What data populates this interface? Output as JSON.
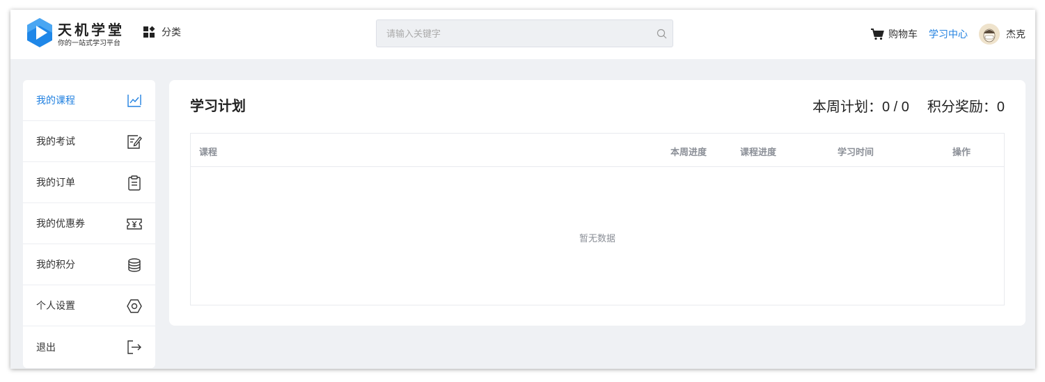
{
  "header": {
    "logo_title": "天机学堂",
    "logo_subtitle": "你的一站式学习平台",
    "category_label": "分类",
    "search_placeholder": "请输入关键字",
    "cart_label": "购物车",
    "study_center_label": "学习中心",
    "username": "杰克"
  },
  "sidebar": {
    "items": [
      {
        "label": "我的课程",
        "icon": "chart-icon",
        "active": true
      },
      {
        "label": "我的考试",
        "icon": "edit-icon"
      },
      {
        "label": "我的订单",
        "icon": "clipboard-icon"
      },
      {
        "label": "我的优惠券",
        "icon": "coupon-icon"
      },
      {
        "label": "我的积分",
        "icon": "coins-icon"
      },
      {
        "label": "个人设置",
        "icon": "settings-icon"
      },
      {
        "label": "退出",
        "icon": "logout-icon"
      }
    ]
  },
  "main": {
    "title": "学习计划",
    "weekly_plan": "本周计划：0 / 0",
    "points_reward": "积分奖励：0",
    "columns": [
      "课程",
      "本周进度",
      "课程进度",
      "学习时间",
      "操作"
    ],
    "empty_text": "暂无数据"
  },
  "colors": {
    "accent": "#2080e0",
    "background": "#eff1f4"
  }
}
